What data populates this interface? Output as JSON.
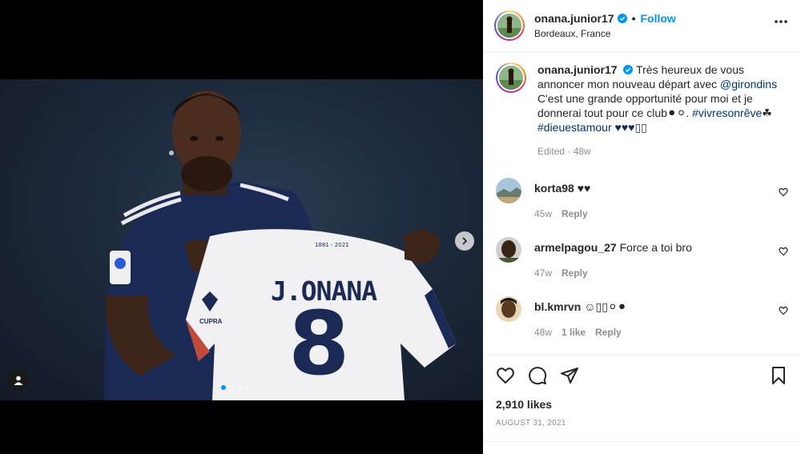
{
  "post": {
    "username": "onana.junior17",
    "location": "Bordeaux, France",
    "follow_label": "Follow",
    "separator": "•",
    "caption": {
      "part1": "Très heureux de vous annoncer mon nouveau départ avec ",
      "mention": "@girondins",
      "part2": " C'est une grande opportunité pour moi et je donnerai tout pour ce club",
      "emoji1": "⚫⚪.",
      "hashtag1": "#vivresonrêve",
      "clover": "☘",
      "hashtag2": "#dieuestamour",
      "hearts": "♥♥♥▯▯"
    },
    "edited_meta": "Edited · 48w",
    "likes": "2,910 likes",
    "date": "AUGUST 31, 2021",
    "shirt_name": "J.ONANA",
    "shirt_number": "8",
    "shirt_years": "1881 - 2021",
    "sponsor": "CUPRA"
  },
  "comments": [
    {
      "username": "korta98",
      "text": "♥♥",
      "age": "45w",
      "likes": "",
      "reply_label": "Reply"
    },
    {
      "username": "armelpagou_27",
      "text": "Force a toi bro",
      "age": "47w",
      "likes": "",
      "reply_label": "Reply"
    },
    {
      "username": "bl.kmrvn",
      "text": "☺▯▯⚪⚫",
      "age": "48w",
      "likes": "1 like",
      "reply_label": "Reply"
    }
  ],
  "colors": {
    "accent": "#0095f6",
    "link": "#00376b",
    "muted": "#8e8e8e"
  },
  "icons": [
    "verified-badge-icon",
    "more-options-icon",
    "heart-icon",
    "comment-icon",
    "share-icon",
    "bookmark-icon",
    "chevron-right-icon",
    "user-tag-icon"
  ]
}
